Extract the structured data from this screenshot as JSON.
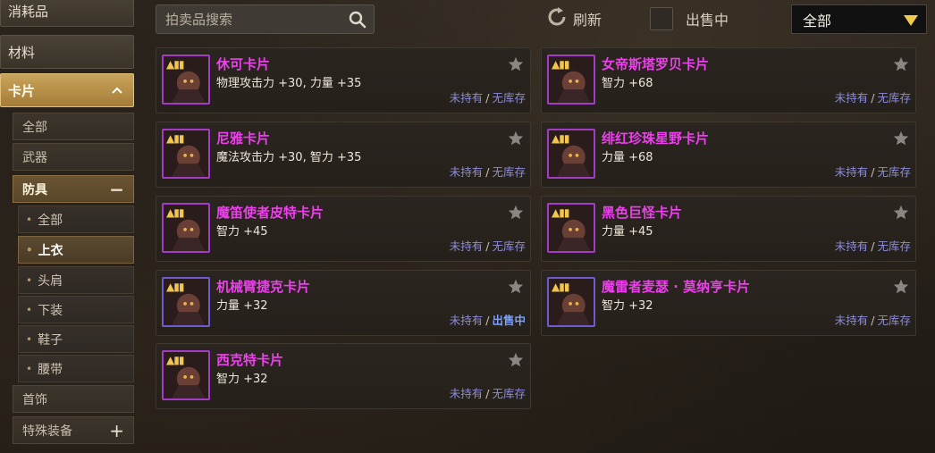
{
  "sidebar": {
    "categories": [
      {
        "label": "消耗品"
      },
      {
        "label": "材料"
      },
      {
        "label": "卡片",
        "expanded": true
      }
    ],
    "card_subs": [
      {
        "label": "全部"
      },
      {
        "label": "武器"
      },
      {
        "label": "防具",
        "expanded": true
      },
      {
        "label": "首饰"
      },
      {
        "label": "特殊装备",
        "expanded": false
      }
    ],
    "armor_leaves": [
      {
        "label": "全部"
      },
      {
        "label": "上衣",
        "selected": true
      },
      {
        "label": "头肩"
      },
      {
        "label": "下装"
      },
      {
        "label": "鞋子"
      },
      {
        "label": "腰带"
      }
    ],
    "collapse_symbol": "−",
    "expand_symbol": "+"
  },
  "topbar": {
    "search_placeholder": "拍卖品搜索",
    "refresh_label": "刷新",
    "on_sale_label": "出售中",
    "on_sale_checked": false,
    "filter_value": "全部"
  },
  "status_labels": {
    "not_owned": "未持有",
    "no_stock": "无库存",
    "on_sale": "出售中",
    "separator": "/"
  },
  "colors": {
    "card_name": "#ee3fee",
    "accent_gold": "#c9a45c",
    "status_blue": "#8c8cd8",
    "on_sale_blue": "#7aa0ff"
  },
  "cards": [
    {
      "name": "休可卡片",
      "stat": "物理攻击力 +30, 力量 +35",
      "owned": "未持有",
      "market": "无库存",
      "frame": "purple",
      "icon": "card-portrait-icon"
    },
    {
      "name": "女帝斯塔罗贝卡片",
      "stat": "智力 +68",
      "owned": "未持有",
      "market": "无库存",
      "frame": "purple",
      "icon": "card-portrait-icon"
    },
    {
      "name": "尼雅卡片",
      "stat": "魔法攻击力 +30, 智力 +35",
      "owned": "未持有",
      "market": "无库存",
      "frame": "purple",
      "icon": "card-portrait-icon"
    },
    {
      "name": "绯红珍珠星野卡片",
      "stat": "力量 +68",
      "owned": "未持有",
      "market": "无库存",
      "frame": "purple",
      "icon": "card-portrait-icon"
    },
    {
      "name": "魔笛使者皮特卡片",
      "stat": "智力 +45",
      "owned": "未持有",
      "market": "无库存",
      "frame": "purple",
      "icon": "card-portrait-icon"
    },
    {
      "name": "黑色巨怪卡片",
      "stat": "力量 +45",
      "owned": "未持有",
      "market": "无库存",
      "frame": "purple",
      "icon": "card-portrait-icon"
    },
    {
      "name": "机械臂捷克卡片",
      "stat": "力量 +32",
      "owned": "未持有",
      "market": "出售中",
      "frame": "blue",
      "icon": "card-portrait-icon"
    },
    {
      "name": "魔雷者麦瑟 · 莫纳亨卡片",
      "stat": "智力 +32",
      "owned": "未持有",
      "market": "无库存",
      "frame": "blue",
      "icon": "card-portrait-icon"
    },
    {
      "name": "西克特卡片",
      "stat": "智力 +32",
      "owned": "未持有",
      "market": "无库存",
      "frame": "purple",
      "icon": "card-portrait-icon"
    }
  ]
}
